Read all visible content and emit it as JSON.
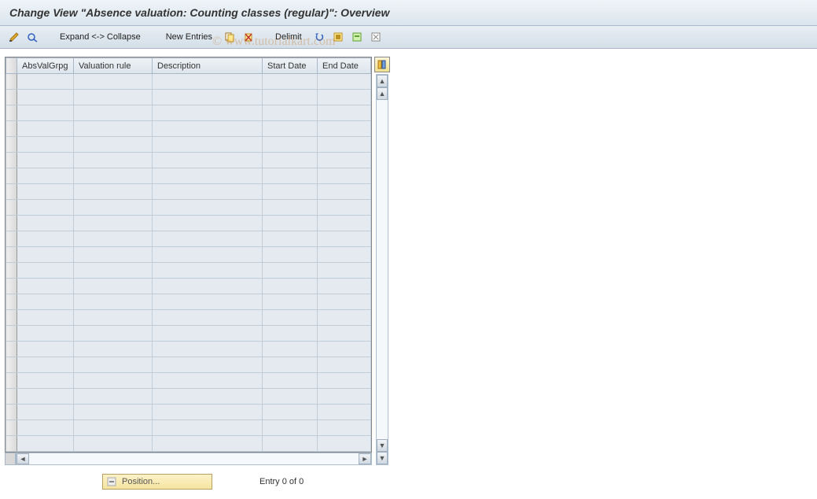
{
  "title": "Change View \"Absence valuation: Counting classes (regular)\": Overview",
  "watermark": "© www.tutorialkart.com",
  "toolbar": {
    "expand_collapse": "Expand <-> Collapse",
    "new_entries": "New Entries",
    "delimit": "Delimit",
    "icons": {
      "change": "change-display-icon",
      "other": "other-view-icon",
      "copy": "copy-icon",
      "delete": "delete-icon",
      "undo": "undo-icon",
      "select_all": "select-all-icon",
      "select_block": "select-block-icon",
      "deselect": "deselect-icon"
    }
  },
  "table": {
    "columns": [
      "AbsValGrpg",
      "Valuation rule",
      "Description",
      "Start Date",
      "End Date"
    ],
    "row_count": 24,
    "config_icon": "table-settings-icon"
  },
  "footer": {
    "position_label": "Position...",
    "entry_text": "Entry 0 of 0"
  }
}
